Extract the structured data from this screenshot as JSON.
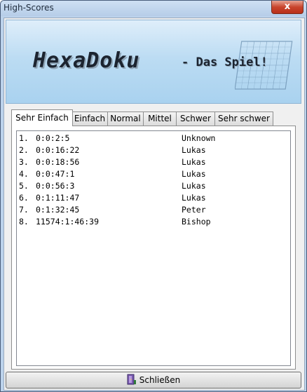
{
  "window": {
    "title": "High-Scores",
    "close_glyph": "x"
  },
  "banner": {
    "title": "HexaDoku",
    "subtitle": "- Das Spiel!"
  },
  "tabs": [
    {
      "label": "Sehr Einfach",
      "active": true
    },
    {
      "label": "Einfach",
      "active": false
    },
    {
      "label": "Normal",
      "active": false
    },
    {
      "label": "Mittel",
      "active": false
    },
    {
      "label": "Schwer",
      "active": false
    },
    {
      "label": "Sehr schwer",
      "active": false
    }
  ],
  "scores": [
    {
      "rank": "1.",
      "time": "0:0:2:5",
      "name": "Unknown"
    },
    {
      "rank": "2.",
      "time": "0:0:16:22",
      "name": "Lukas"
    },
    {
      "rank": "3.",
      "time": "0:0:18:56",
      "name": "Lukas"
    },
    {
      "rank": "4.",
      "time": "0:0:47:1",
      "name": "Lukas"
    },
    {
      "rank": "5.",
      "time": "0:0:56:3",
      "name": "Lukas"
    },
    {
      "rank": "6.",
      "time": "0:1:11:47",
      "name": "Lukas"
    },
    {
      "rank": "7.",
      "time": "0:1:32:45",
      "name": "Peter"
    },
    {
      "rank": "8.",
      "time": "11574:1:46:39",
      "name": "Bishop"
    }
  ],
  "footer": {
    "close_label": "Schließen",
    "icon": "door-exit-icon"
  }
}
